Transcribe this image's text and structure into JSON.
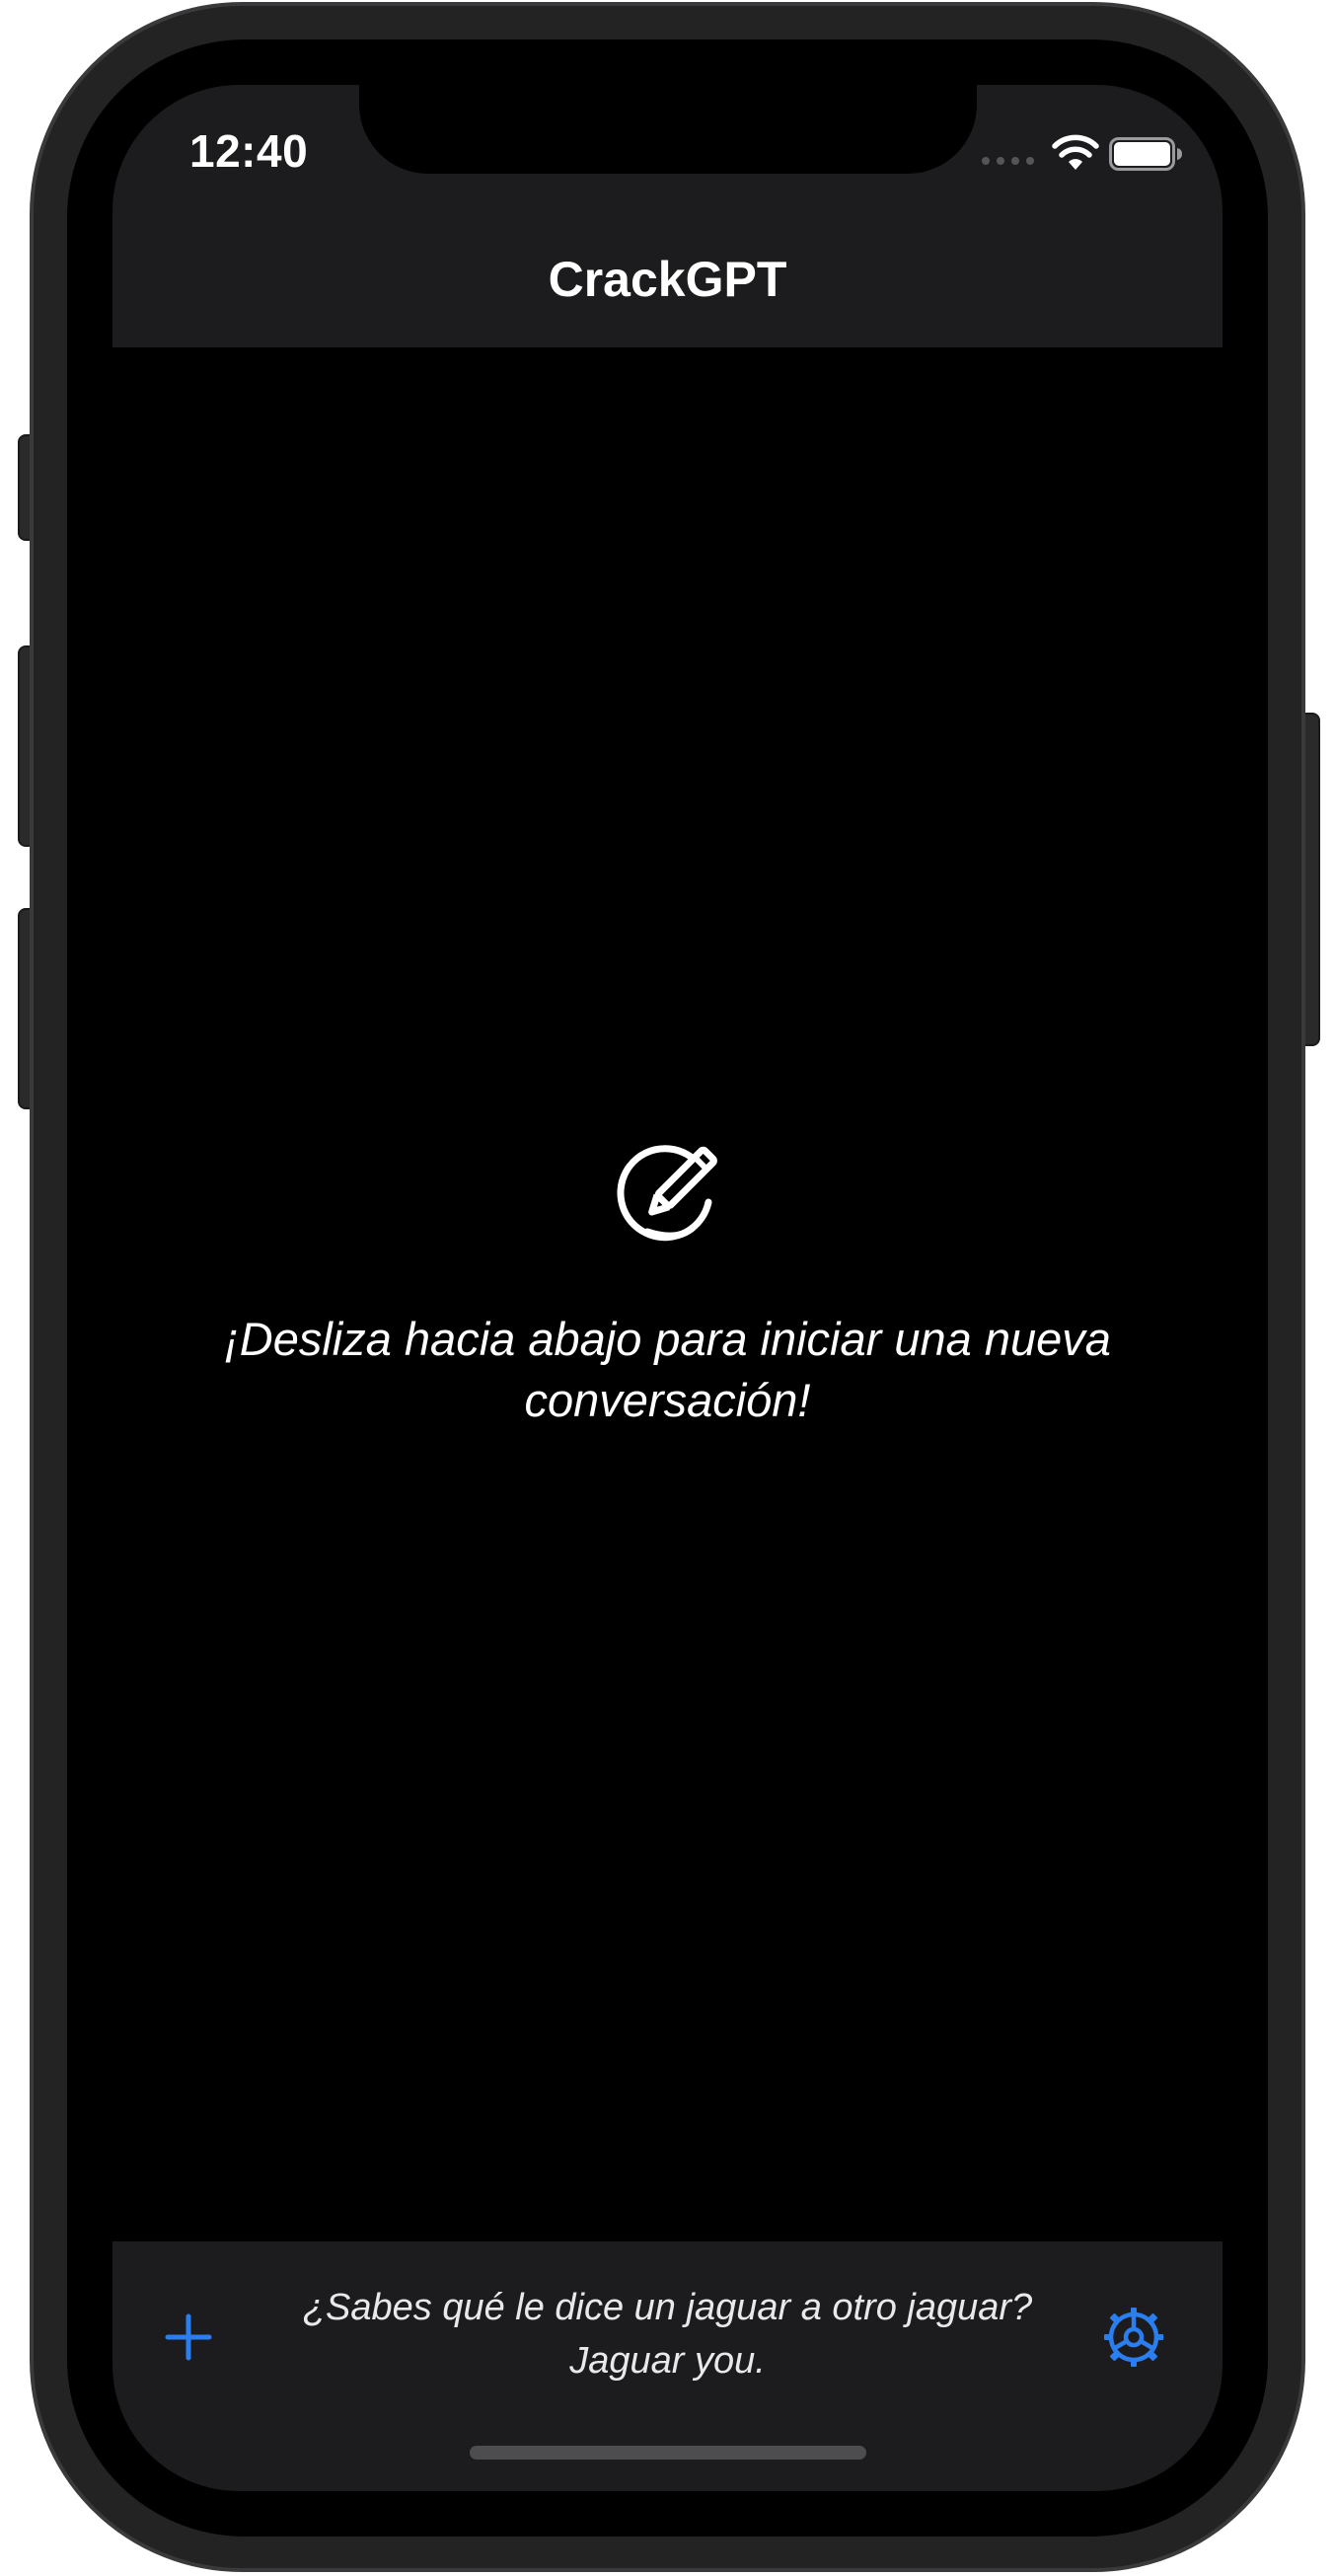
{
  "status_bar": {
    "time": "12:40",
    "signal_icon": "signal-dots-icon",
    "wifi_icon": "wifi-icon",
    "battery_icon": "battery-icon"
  },
  "nav": {
    "title": "CrackGPT"
  },
  "empty_state": {
    "icon": "compose-pencil-icon",
    "message": "¡Desliza hacia abajo para iniciar una nueva conversación!"
  },
  "toolbar": {
    "add_icon": "plus-icon",
    "joke": "¿Sabes qué le dice un jaguar a otro jaguar? Jaguar you.",
    "settings_icon": "gear-icon"
  },
  "colors": {
    "background": "#000000",
    "bar_background": "#1c1c1e",
    "accent": "#2b7ef0",
    "text": "#ffffff"
  }
}
